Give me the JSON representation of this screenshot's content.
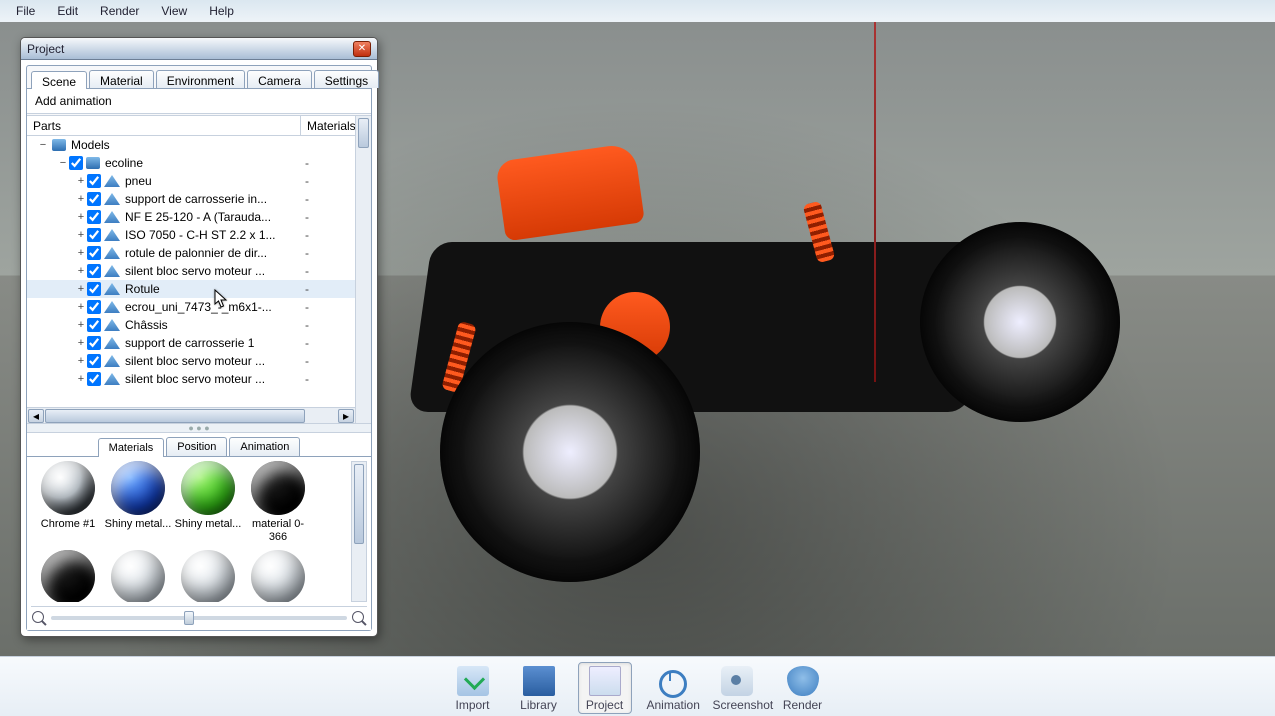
{
  "menu": {
    "items": [
      "File",
      "Edit",
      "Render",
      "View",
      "Help"
    ]
  },
  "project_window": {
    "title": "Project",
    "tabs": [
      "Scene",
      "Material",
      "Environment",
      "Camera",
      "Settings"
    ],
    "active_tab": 0,
    "add_animation": "Add animation",
    "tree_headers": {
      "parts": "Parts",
      "materials": "Materials"
    },
    "root": {
      "label": "Models"
    },
    "ecoline": {
      "label": "ecoline"
    },
    "items": [
      {
        "label": "pneu",
        "mat": "-"
      },
      {
        "label": "support de carrosserie in...",
        "mat": "-"
      },
      {
        "label": "NF E 25-120 - A  (Tarauda...",
        "mat": "-"
      },
      {
        "label": "ISO 7050 - C-H ST 2.2 x 1...",
        "mat": "-"
      },
      {
        "label": "rotule de palonnier de dir...",
        "mat": "-"
      },
      {
        "label": "silent bloc servo moteur ...",
        "mat": "-"
      },
      {
        "label": "Rotule",
        "mat": "-"
      },
      {
        "label": "ecrou_uni_7473_-_m6x1-...",
        "mat": "-"
      },
      {
        "label": "Châssis",
        "mat": "-"
      },
      {
        "label": "support de carrosserie 1",
        "mat": "-"
      },
      {
        "label": "silent bloc servo moteur ...",
        "mat": "-"
      },
      {
        "label": "silent bloc servo moteur ...",
        "mat": "-"
      }
    ],
    "hover_index": 6,
    "lower_tabs": [
      "Materials",
      "Position",
      "Animation"
    ],
    "lower_active": 0,
    "materials": [
      {
        "name": "Chrome #1",
        "color": "radial-gradient(circle at 35% 30%,#fff,#c7cfd6 40%,#3c4248 70%,#1b1f23)"
      },
      {
        "name": "Shiny metal...",
        "color": "radial-gradient(circle at 35% 30%,#6aa8ff,#1544c6 60%,#06155a)"
      },
      {
        "name": "Shiny metal...",
        "color": "radial-gradient(circle at 35% 30%,#9af06a,#36c418 60%,#0c5a06)"
      },
      {
        "name": "material 0-366",
        "color": "radial-gradient(circle at 35% 30%,#222,#000 70%)"
      },
      {
        "name": "",
        "color": "radial-gradient(circle at 35% 30%,#222,#000 70%)"
      },
      {
        "name": "",
        "color": "radial-gradient(circle at 35% 30%,#fff,#dbe3ea 60%,#9fadba)"
      },
      {
        "name": "",
        "color": "radial-gradient(circle at 35% 30%,#fff,#dbe3ea 60%,#9fadba)"
      },
      {
        "name": "",
        "color": "radial-gradient(circle at 35% 30%,#fff,#dbe3ea 60%,#9fadba)"
      }
    ]
  },
  "toolbar": {
    "items": [
      {
        "label": "Import",
        "icon": "import"
      },
      {
        "label": "Library",
        "icon": "library"
      },
      {
        "label": "Project",
        "icon": "project"
      },
      {
        "label": "Animation",
        "icon": "animation"
      },
      {
        "label": "Screenshot",
        "icon": "screenshot"
      },
      {
        "label": "Render",
        "icon": "render"
      }
    ],
    "active_index": 2
  }
}
